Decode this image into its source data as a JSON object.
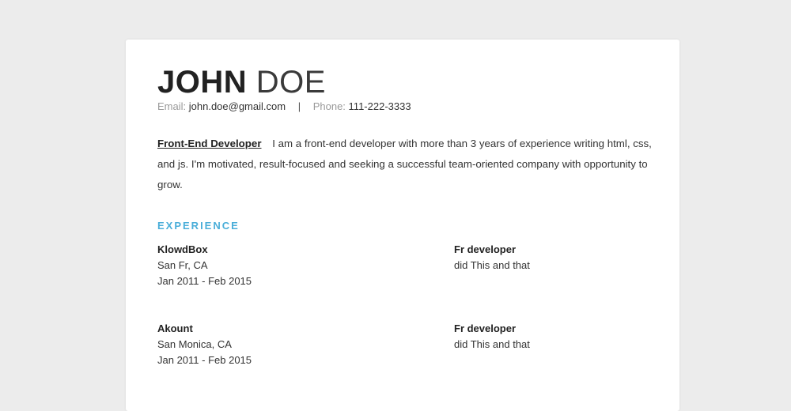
{
  "header": {
    "first_name": "JOHN",
    "last_name": "DOE",
    "email_label": "Email:",
    "email": "john.doe@gmail.com",
    "separator": "|",
    "phone_label": "Phone:",
    "phone": "111-222-3333"
  },
  "summary": {
    "role": "Front-End Developer",
    "text": "I am a front-end developer with more than 3 years of experience writing html, css, and js. I'm motivated, result-focused and seeking a successful team-oriented company with opportunity to grow."
  },
  "experience": {
    "title": "EXPERIENCE",
    "jobs": [
      {
        "company": "KlowdBox",
        "location": "San Fr, CA",
        "dates": "Jan 2011 - Feb 2015",
        "position": "Fr developer",
        "description": "did This and that"
      },
      {
        "company": "Akount",
        "location": "San Monica, CA",
        "dates": "Jan 2011 - Feb 2015",
        "position": "Fr developer",
        "description": "did This and that"
      }
    ]
  },
  "colors": {
    "background": "#ececec",
    "paper": "#ffffff",
    "accent": "#4aaed9",
    "text": "#333333"
  }
}
